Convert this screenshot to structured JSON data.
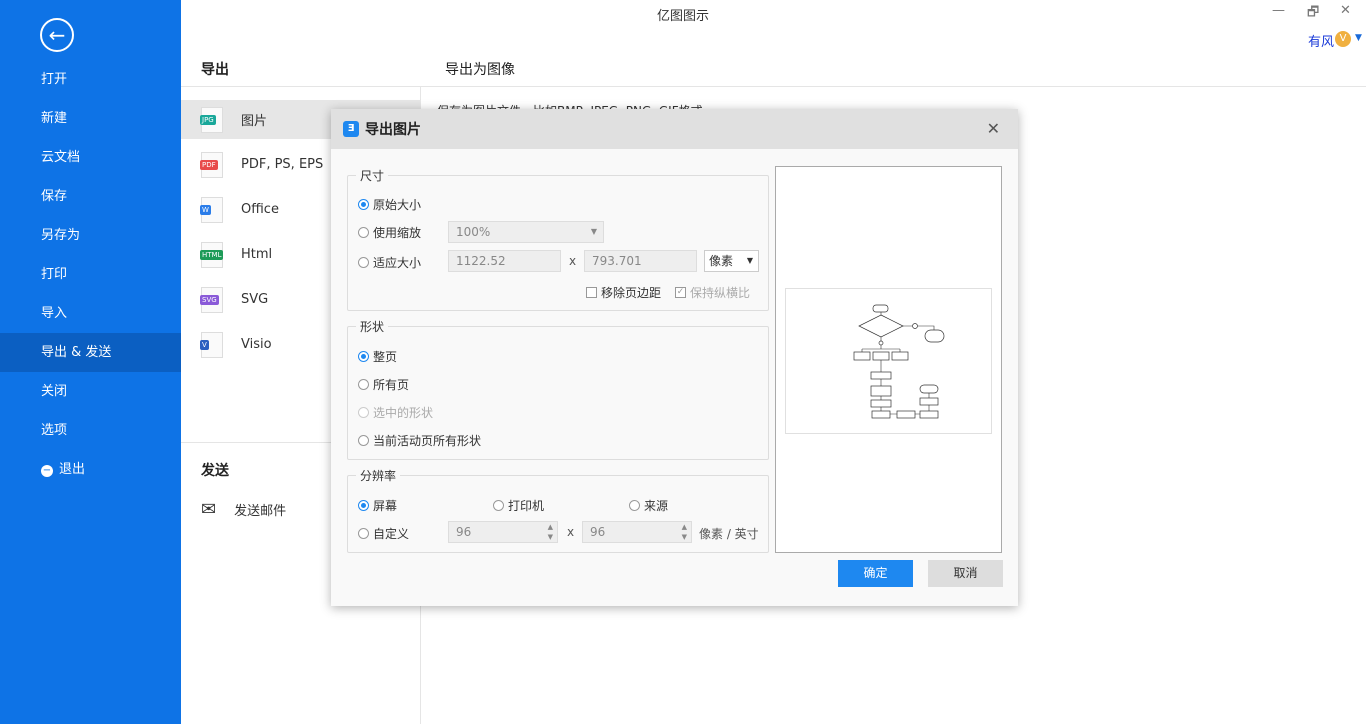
{
  "app_title": "亿图图示",
  "window_controls": {
    "minimize": "—",
    "restore": "🗗",
    "close": "✕"
  },
  "user": {
    "name": "有风",
    "vip_badge": "V"
  },
  "sidebar": {
    "back": "←",
    "items": [
      {
        "label": "打开"
      },
      {
        "label": "新建"
      },
      {
        "label": "云文档"
      },
      {
        "label": "保存"
      },
      {
        "label": "另存为"
      },
      {
        "label": "打印"
      },
      {
        "label": "导入"
      },
      {
        "label": "导出 & 发送",
        "active": true
      },
      {
        "label": "关闭"
      },
      {
        "label": "选项"
      },
      {
        "label": "退出",
        "icon": "minus-circle-icon"
      }
    ]
  },
  "export": {
    "heading": "导出",
    "formats": [
      {
        "label": "图片",
        "badge": "JPG",
        "color": "#1aa89a",
        "active": true
      },
      {
        "label": "PDF, PS, EPS",
        "badge": "PDF",
        "color": "#e84b4b"
      },
      {
        "label": "Office",
        "badge": "W",
        "color": "#2b7de9"
      },
      {
        "label": "Html",
        "badge": "HTML",
        "color": "#1e9b58"
      },
      {
        "label": "SVG",
        "badge": "SVG",
        "color": "#8a5ad8"
      },
      {
        "label": "Visio",
        "badge": "V",
        "color": "#2b5fc0"
      }
    ]
  },
  "send": {
    "heading": "发送",
    "email": "发送邮件"
  },
  "content": {
    "heading": "导出为图像",
    "description": "保存为图片文件，比如BMP, JPEG, PNG, GIF格式。"
  },
  "dialog": {
    "title": "导出图片",
    "close": "✕",
    "size": {
      "legend": "尺寸",
      "original": "原始大小",
      "use_zoom": "使用缩放",
      "zoom_value": "100%",
      "fit": "适应大小",
      "width": "1122.52",
      "x": "x",
      "height": "793.701",
      "unit": "像素",
      "remove_margin": "移除页边距",
      "keep_ratio": "保持纵横比"
    },
    "shape": {
      "legend": "形状",
      "whole_page": "整页",
      "all_pages": "所有页",
      "selected": "选中的形状",
      "current_all": "当前活动页所有形状"
    },
    "resolution": {
      "legend": "分辨率",
      "screen": "屏幕",
      "printer": "打印机",
      "source": "来源",
      "custom": "自定义",
      "dpi_x": "96",
      "x": "x",
      "dpi_y": "96",
      "unit": "像素 / 英寸"
    },
    "ok": "确定",
    "cancel": "取消"
  },
  "colors": {
    "accent": "#0e73e6",
    "primary_button": "#1e88f0"
  }
}
